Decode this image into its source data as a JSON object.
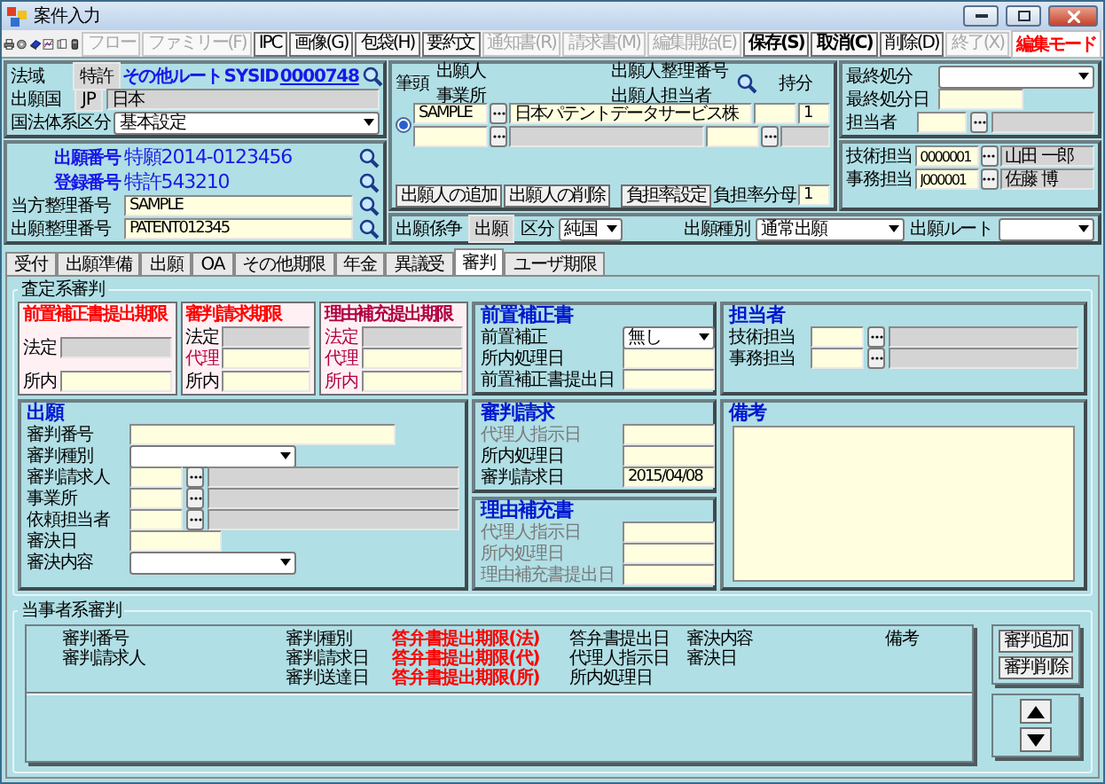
{
  "window": {
    "title": "案件入力"
  },
  "toolbar": {
    "buttons": [
      {
        "label": "フロー",
        "disabled": true,
        "bold": false
      },
      {
        "label": "ファミリー(F)",
        "disabled": true,
        "bold": false
      },
      {
        "label": "IPC",
        "disabled": false,
        "bold": false
      },
      {
        "label": "画像(G)",
        "disabled": false,
        "bold": false
      },
      {
        "label": "包袋(H)",
        "disabled": false,
        "bold": false
      },
      {
        "label": "要約文",
        "disabled": false,
        "bold": false
      },
      {
        "label": "通知書(R)",
        "disabled": true,
        "bold": false
      },
      {
        "label": "請求書(M)",
        "disabled": true,
        "bold": false
      },
      {
        "label": "編集開始(E)",
        "disabled": true,
        "bold": false
      },
      {
        "label": "保存(S)",
        "disabled": false,
        "bold": true
      },
      {
        "label": "取消(C)",
        "disabled": false,
        "bold": true
      },
      {
        "label": "削除(D)",
        "disabled": false,
        "bold": false
      },
      {
        "label": "終了(X)",
        "disabled": true,
        "bold": false
      }
    ],
    "mode": "編集モード"
  },
  "case": {
    "law_label": "法域",
    "law": "特許",
    "route": "その他ルート",
    "sysid_label": "SYSID",
    "sysid": "0000748",
    "country_label": "出願国",
    "country_code": "JP",
    "country_name": "日本",
    "system_label": "国法体系区分",
    "system": "基本設定"
  },
  "numbers": {
    "application_label": "出願番号",
    "application": "特願2014-0123456",
    "registration_label": "登録番号",
    "registration": "特許543210",
    "refs": [
      {
        "label": "当方整理番号",
        "value": "SAMPLE"
      },
      {
        "label": "出願整理番号",
        "value": "PATENT012345"
      }
    ]
  },
  "applicants": {
    "headers": {
      "lead": "筆頭",
      "applicant": "出願人",
      "office": "事業所",
      "ref": "出願人整理番号",
      "contact": "出願人担当者",
      "share": "持分"
    },
    "rows": [
      {
        "selected": true,
        "code": "SAMPLE",
        "name": "日本パテントデータサービス株",
        "share": "1"
      }
    ],
    "buttons": [
      "出願人の追加",
      "出願人の削除",
      "負担率設定"
    ],
    "ratio_label": "負担率分母",
    "ratio": "1"
  },
  "filing": {
    "stage_label": "出願係争",
    "stage": "出願",
    "class_label": "区分",
    "class": "純国",
    "type_label": "出願種別",
    "type": "通常出願",
    "route_label": "出願ルート"
  },
  "disposal": {
    "final_label": "最終処分",
    "final_date_label": "最終処分日",
    "person_label": "担当者"
  },
  "staff": [
    {
      "label": "技術担当",
      "code": "0000001",
      "name": "山田 一郎"
    },
    {
      "label": "事務担当",
      "code": "J000001",
      "name": "佐藤 博"
    }
  ],
  "tabs": [
    {
      "label": "受付",
      "selected": false
    },
    {
      "label": "出願準備",
      "selected": false
    },
    {
      "label": "出願",
      "selected": false
    },
    {
      "label": "OA",
      "selected": false
    },
    {
      "label": "その他期限",
      "selected": false
    },
    {
      "label": "年金",
      "selected": false
    },
    {
      "label": "異議受",
      "selected": false
    },
    {
      "label": "審判",
      "selected": true
    },
    {
      "label": "ユーザ期限",
      "selected": false
    }
  ],
  "examination": {
    "title": "査定系審判",
    "deadlines": [
      {
        "title": "前置補正書提出期限",
        "color": "#ff0000",
        "fields": [
          {
            "label": "法定",
            "color": "#000000",
            "disabled": true
          },
          {
            "label": "所内",
            "color": "#000000",
            "disabled": false
          }
        ]
      },
      {
        "title": "審判請求期限",
        "color": "#ff0000",
        "fields": [
          {
            "label": "法定",
            "color": "#000000",
            "disabled": true
          },
          {
            "label": "代理",
            "color": "#c00040",
            "disabled": false
          },
          {
            "label": "所内",
            "color": "#000000",
            "disabled": false
          }
        ]
      },
      {
        "title": "理由補充提出期限",
        "color": "#b00040",
        "fields": [
          {
            "label": "法定",
            "color": "#b00040",
            "disabled": true
          },
          {
            "label": "代理",
            "color": "#b00040",
            "disabled": false
          },
          {
            "label": "所内",
            "color": "#b00040",
            "disabled": false
          }
        ]
      }
    ],
    "amendment": {
      "title": "前置補正書",
      "rows": [
        {
          "kind": "select",
          "label": "前置補正",
          "value": "無し",
          "dimmed": false
        },
        {
          "kind": "date",
          "label": "所内処理日",
          "dimmed": false
        },
        {
          "kind": "date",
          "label": "前置補正書提出日",
          "dimmed": false
        }
      ]
    },
    "assignees": {
      "title": "担当者",
      "rows": [
        {
          "kind": "lookup",
          "label": "技術担当",
          "dimmed": false
        },
        {
          "kind": "lookup",
          "label": "事務担当",
          "dimmed": false
        }
      ]
    },
    "appeal": {
      "title": "出願",
      "rows": [
        {
          "kind": "text",
          "label": "審判番号",
          "dimmed": false
        },
        {
          "kind": "select",
          "label": "審判種別",
          "dimmed": false
        },
        {
          "kind": "lookup",
          "label": "審判請求人",
          "dimmed": false
        },
        {
          "kind": "lookup",
          "label": "事業所",
          "dimmed": false
        },
        {
          "kind": "lookup",
          "label": "依頼担当者",
          "dimmed": false
        },
        {
          "kind": "date",
          "label": "審決日",
          "dimmed": false
        },
        {
          "kind": "select",
          "label": "審決内容",
          "dimmed": false
        }
      ]
    },
    "request": {
      "title": "審判請求",
      "rows": [
        {
          "kind": "date",
          "label": "代理人指示日",
          "dimmed": true
        },
        {
          "kind": "date",
          "label": "所内処理日",
          "dimmed": false
        },
        {
          "kind": "date",
          "label": "審判請求日",
          "value": "2015/04/08",
          "dimmed": false
        }
      ]
    },
    "supplement": {
      "title": "理由補充書",
      "rows": [
        {
          "kind": "date",
          "label": "代理人指示日",
          "dimmed": true
        },
        {
          "kind": "date",
          "label": "所内処理日",
          "dimmed": true
        },
        {
          "kind": "date",
          "label": "理由補充書提出日",
          "dimmed": true
        }
      ]
    },
    "notes": {
      "title": "備考"
    }
  },
  "inter_partes": {
    "title": "当事者系審判",
    "columns": [
      {
        "color": "#000000",
        "labels": [
          "審判番号",
          "審判請求人"
        ]
      },
      {
        "color": "#000000",
        "labels": [
          "審判種別",
          "審判請求日",
          "審判送達日"
        ]
      },
      {
        "color": "#ff0000",
        "labels": [
          "答弁書提出期限(法)",
          "答弁書提出期限(代)",
          "答弁書提出期限(所)"
        ]
      },
      {
        "color": "#000000",
        "labels": [
          "答弁書提出日",
          "代理人指示日",
          "所内処理日"
        ]
      },
      {
        "color": "#000000",
        "labels": [
          "審決内容",
          "審決日"
        ]
      },
      {
        "color": "#000000",
        "labels": [
          "備考"
        ]
      }
    ],
    "buttons": [
      "審判追加",
      "審判削除"
    ]
  }
}
